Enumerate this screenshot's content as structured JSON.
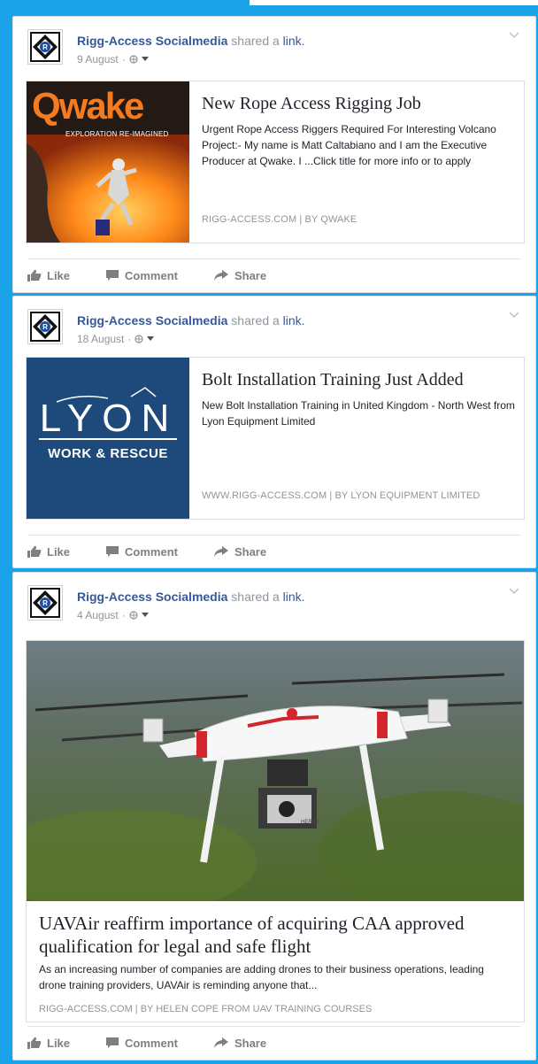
{
  "posts": [
    {
      "author": "Rigg-Access Socialmedia",
      "shared_text": "shared a",
      "link_word": "link.",
      "date": "9 August",
      "card": {
        "title": "New Rope Access Rigging Job",
        "description": "Urgent Rope Access Riggers Required For Interesting Volcano Project:- My name is Matt Caltabiano and I am the Executive Producer at Qwake. I ...Click title for more info or to apply",
        "domain": "RIGG-ACCESS.COM | BY QWAKE",
        "thumb_brand": "Qwake",
        "thumb_tagline": "EXPLORATION RE-IMAGINED"
      }
    },
    {
      "author": "Rigg-Access Socialmedia",
      "shared_text": "shared a",
      "link_word": "link.",
      "date": "18 August",
      "card": {
        "title": "Bolt Installation Training Just Added",
        "description": "New Bolt Installation Training in United Kingdom - North West from Lyon Equipment Limited",
        "domain": "WWW.RIGG-ACCESS.COM | BY LYON EQUIPMENT LIMITED",
        "thumb_brand": "LYON",
        "thumb_tagline": "WORK & RESCUE"
      }
    },
    {
      "author": "Rigg-Access Socialmedia",
      "shared_text": "shared a",
      "link_word": "link.",
      "date": "4 August",
      "card": {
        "title": "UAVAir reaffirm importance of acquiring CAA approved qualification for legal and safe flight",
        "description": "As an increasing number of companies are adding drones to their business operations, leading drone training providers, UAVAir is reminding anyone that...",
        "domain": "RIGG-ACCESS.COM | BY HELEN COPE FROM UAV TRAINING COURSES",
        "camera_label": "HERO3"
      }
    }
  ],
  "actions": {
    "like": "Like",
    "comment": "Comment",
    "share": "Share"
  },
  "colors": {
    "background": "#1aa3e8",
    "link_blue": "#365899",
    "meta_gray": "#90949c",
    "qwake_orange": "#f47b20",
    "lyon_navy": "#1d4a7a"
  },
  "icons": {
    "privacy": "globe-icon",
    "menu": "caret-down-icon",
    "options": "chevron-down-icon",
    "like": "thumbs-up-icon",
    "comment": "comment-icon",
    "share": "share-arrow-icon"
  }
}
